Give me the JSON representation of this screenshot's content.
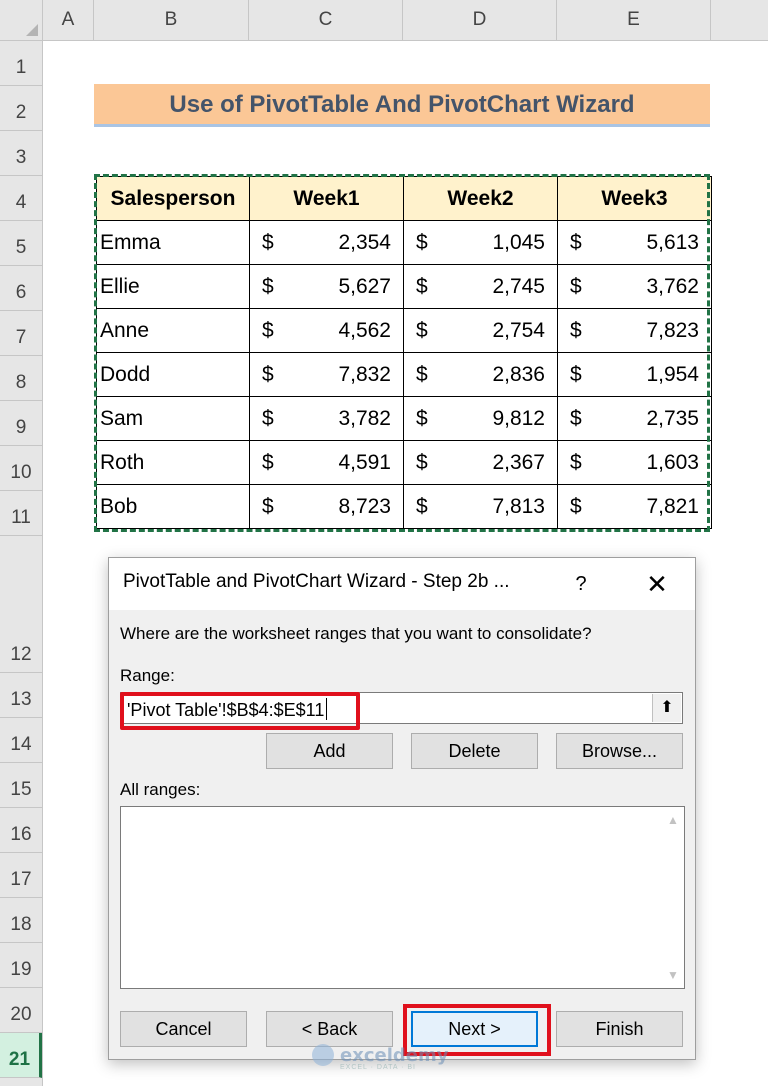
{
  "sheet": {
    "columns": [
      "A",
      "B",
      "C",
      "D",
      "E"
    ],
    "rows": [
      "1",
      "2",
      "3",
      "4",
      "5",
      "6",
      "7",
      "8",
      "9",
      "10",
      "11",
      "12",
      "13",
      "14",
      "15",
      "16",
      "17",
      "18",
      "19",
      "20",
      "21"
    ],
    "selected_row": "21"
  },
  "banner": {
    "title": "Use of PivotTable And PivotChart Wizard"
  },
  "table": {
    "headers": [
      "Salesperson",
      "Week1",
      "Week2",
      "Week3"
    ],
    "currency_symbol": "$",
    "rows": [
      {
        "name": "Emma",
        "w1": "2,354",
        "w2": "1,045",
        "w3": "5,613"
      },
      {
        "name": "Ellie",
        "w1": "5,627",
        "w2": "2,745",
        "w3": "3,762"
      },
      {
        "name": "Anne",
        "w1": "4,562",
        "w2": "2,754",
        "w3": "7,823"
      },
      {
        "name": "Dodd",
        "w1": "7,832",
        "w2": "2,836",
        "w3": "1,954"
      },
      {
        "name": "Sam",
        "w1": "3,782",
        "w2": "9,812",
        "w3": "2,735"
      },
      {
        "name": "Roth",
        "w1": "4,591",
        "w2": "2,367",
        "w3": "1,603"
      },
      {
        "name": "Bob",
        "w1": "8,723",
        "w2": "7,813",
        "w3": "7,821"
      }
    ]
  },
  "dialog": {
    "title": "PivotTable and PivotChart Wizard - Step 2b ...",
    "help_glyph": "?",
    "close_glyph": "✕",
    "prompt": "Where are the worksheet ranges that you want to consolidate?",
    "range_label": "Range:",
    "range_value": "'Pivot Table'!$B$4:$E$11",
    "collapse_glyph": "⬆",
    "buttons": {
      "add": "Add",
      "delete": "Delete",
      "browse": "Browse...",
      "cancel": "Cancel",
      "back": "< Back",
      "next": "Next >",
      "finish": "Finish"
    },
    "all_ranges_label": "All ranges:"
  },
  "colors": {
    "banner_bg": "#fbc796",
    "header_bg": "#fff2cc",
    "selection_green": "#217346",
    "highlight_red": "#e0101c",
    "default_button_blue": "#0078d7"
  },
  "watermark": {
    "brand": "exceldemy",
    "tagline": "EXCEL · DATA · BI"
  }
}
